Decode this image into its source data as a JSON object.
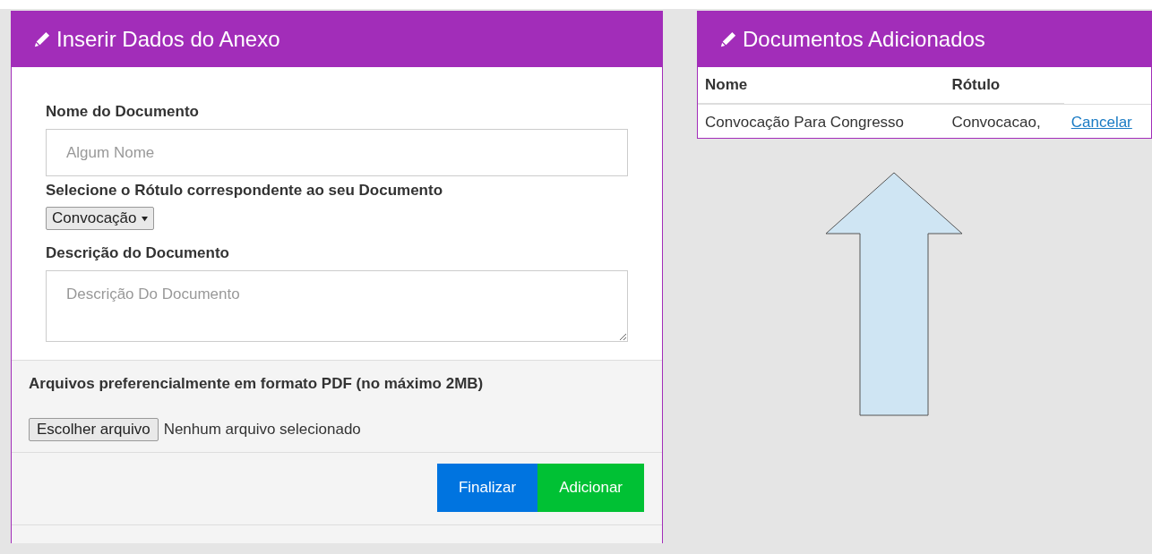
{
  "left_panel": {
    "title": "Inserir Dados do Anexo",
    "fields": [
      {
        "kind": "text",
        "label": "Nome do Documento",
        "placeholder": "Algum Nome"
      },
      {
        "kind": "select",
        "label": "Selecione o Rótulo correspondente ao seu Documento",
        "value": "Convocação"
      },
      {
        "kind": "textarea",
        "label": "Descrição do Documento",
        "placeholder": "Descrição Do Documento"
      }
    ],
    "upload": {
      "note": "Arquivos preferencialmente em formato PDF (no máximo 2MB)",
      "button": "Escolher arquivo",
      "status": "Nenhum arquivo selecionado"
    },
    "buttons": [
      {
        "kind": "primary",
        "label": "Finalizar"
      },
      {
        "kind": "success",
        "label": "Adicionar"
      }
    ]
  },
  "right_panel": {
    "title": "Documentos Adicionados",
    "table": {
      "columns": [
        "Nome",
        "Rótulo"
      ],
      "rows": [
        {
          "cells": [
            "Convocação Para Congresso",
            "Convocacao,"
          ],
          "action": "Cancelar"
        }
      ]
    }
  }
}
